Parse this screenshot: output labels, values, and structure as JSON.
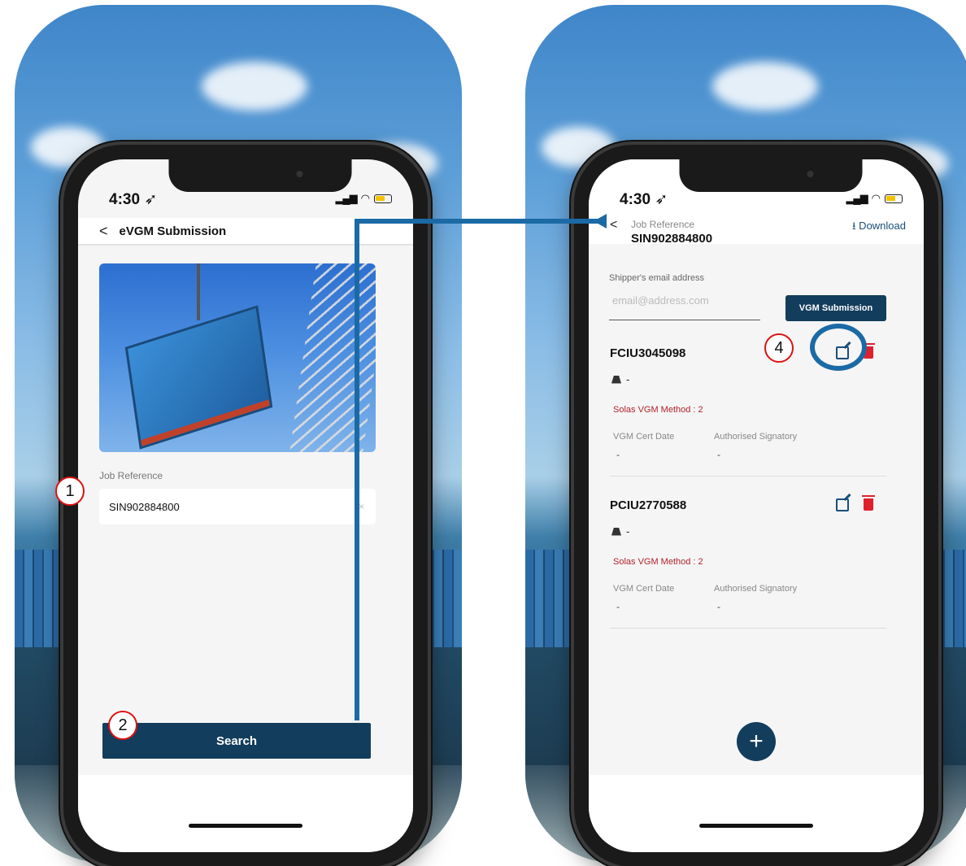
{
  "left_phone": {
    "status_time": "4:30",
    "nav_back": "<",
    "nav_title": "eVGM Submission",
    "job_reference_label": "Job Reference",
    "job_reference_value": "SIN902884800",
    "clear_glyph": "×",
    "search_button": "Search"
  },
  "right_phone": {
    "status_time": "4:30",
    "nav_back": "<",
    "nav_subtitle": "Job Reference",
    "nav_title": "SIN902884800",
    "download_label": "⭳ Download",
    "email_label": "Shipper's email address",
    "email_placeholder": "email@address.com",
    "vgm_button": "VGM Submission",
    "fab_label": "+",
    "containers": [
      {
        "id": "FCIU3045098",
        "weight": "-",
        "solas": "Solas VGM Method : 2",
        "cert_date_label": "VGM Cert Date",
        "cert_date_value": "-",
        "signatory_label": "Authorised Signatory",
        "signatory_value": "-"
      },
      {
        "id": "PCIU2770588",
        "weight": "-",
        "solas": "Solas VGM Method : 2",
        "cert_date_label": "VGM Cert Date",
        "cert_date_value": "-",
        "signatory_label": "Authorised Signatory",
        "signatory_value": "-"
      }
    ]
  },
  "markers": {
    "m1": "1",
    "m2": "2",
    "m4": "4"
  },
  "colors": {
    "primary": "#133d5c",
    "accent_blue": "#1b6aa5",
    "danger": "#e0202f",
    "solas_red": "#b2222c"
  },
  "icons": [
    "location-arrow-icon",
    "signal-icon",
    "wifi-icon",
    "battery-icon",
    "back-chevron-icon",
    "download-icon",
    "edit-icon",
    "trash-icon",
    "weight-icon",
    "plus-icon"
  ]
}
